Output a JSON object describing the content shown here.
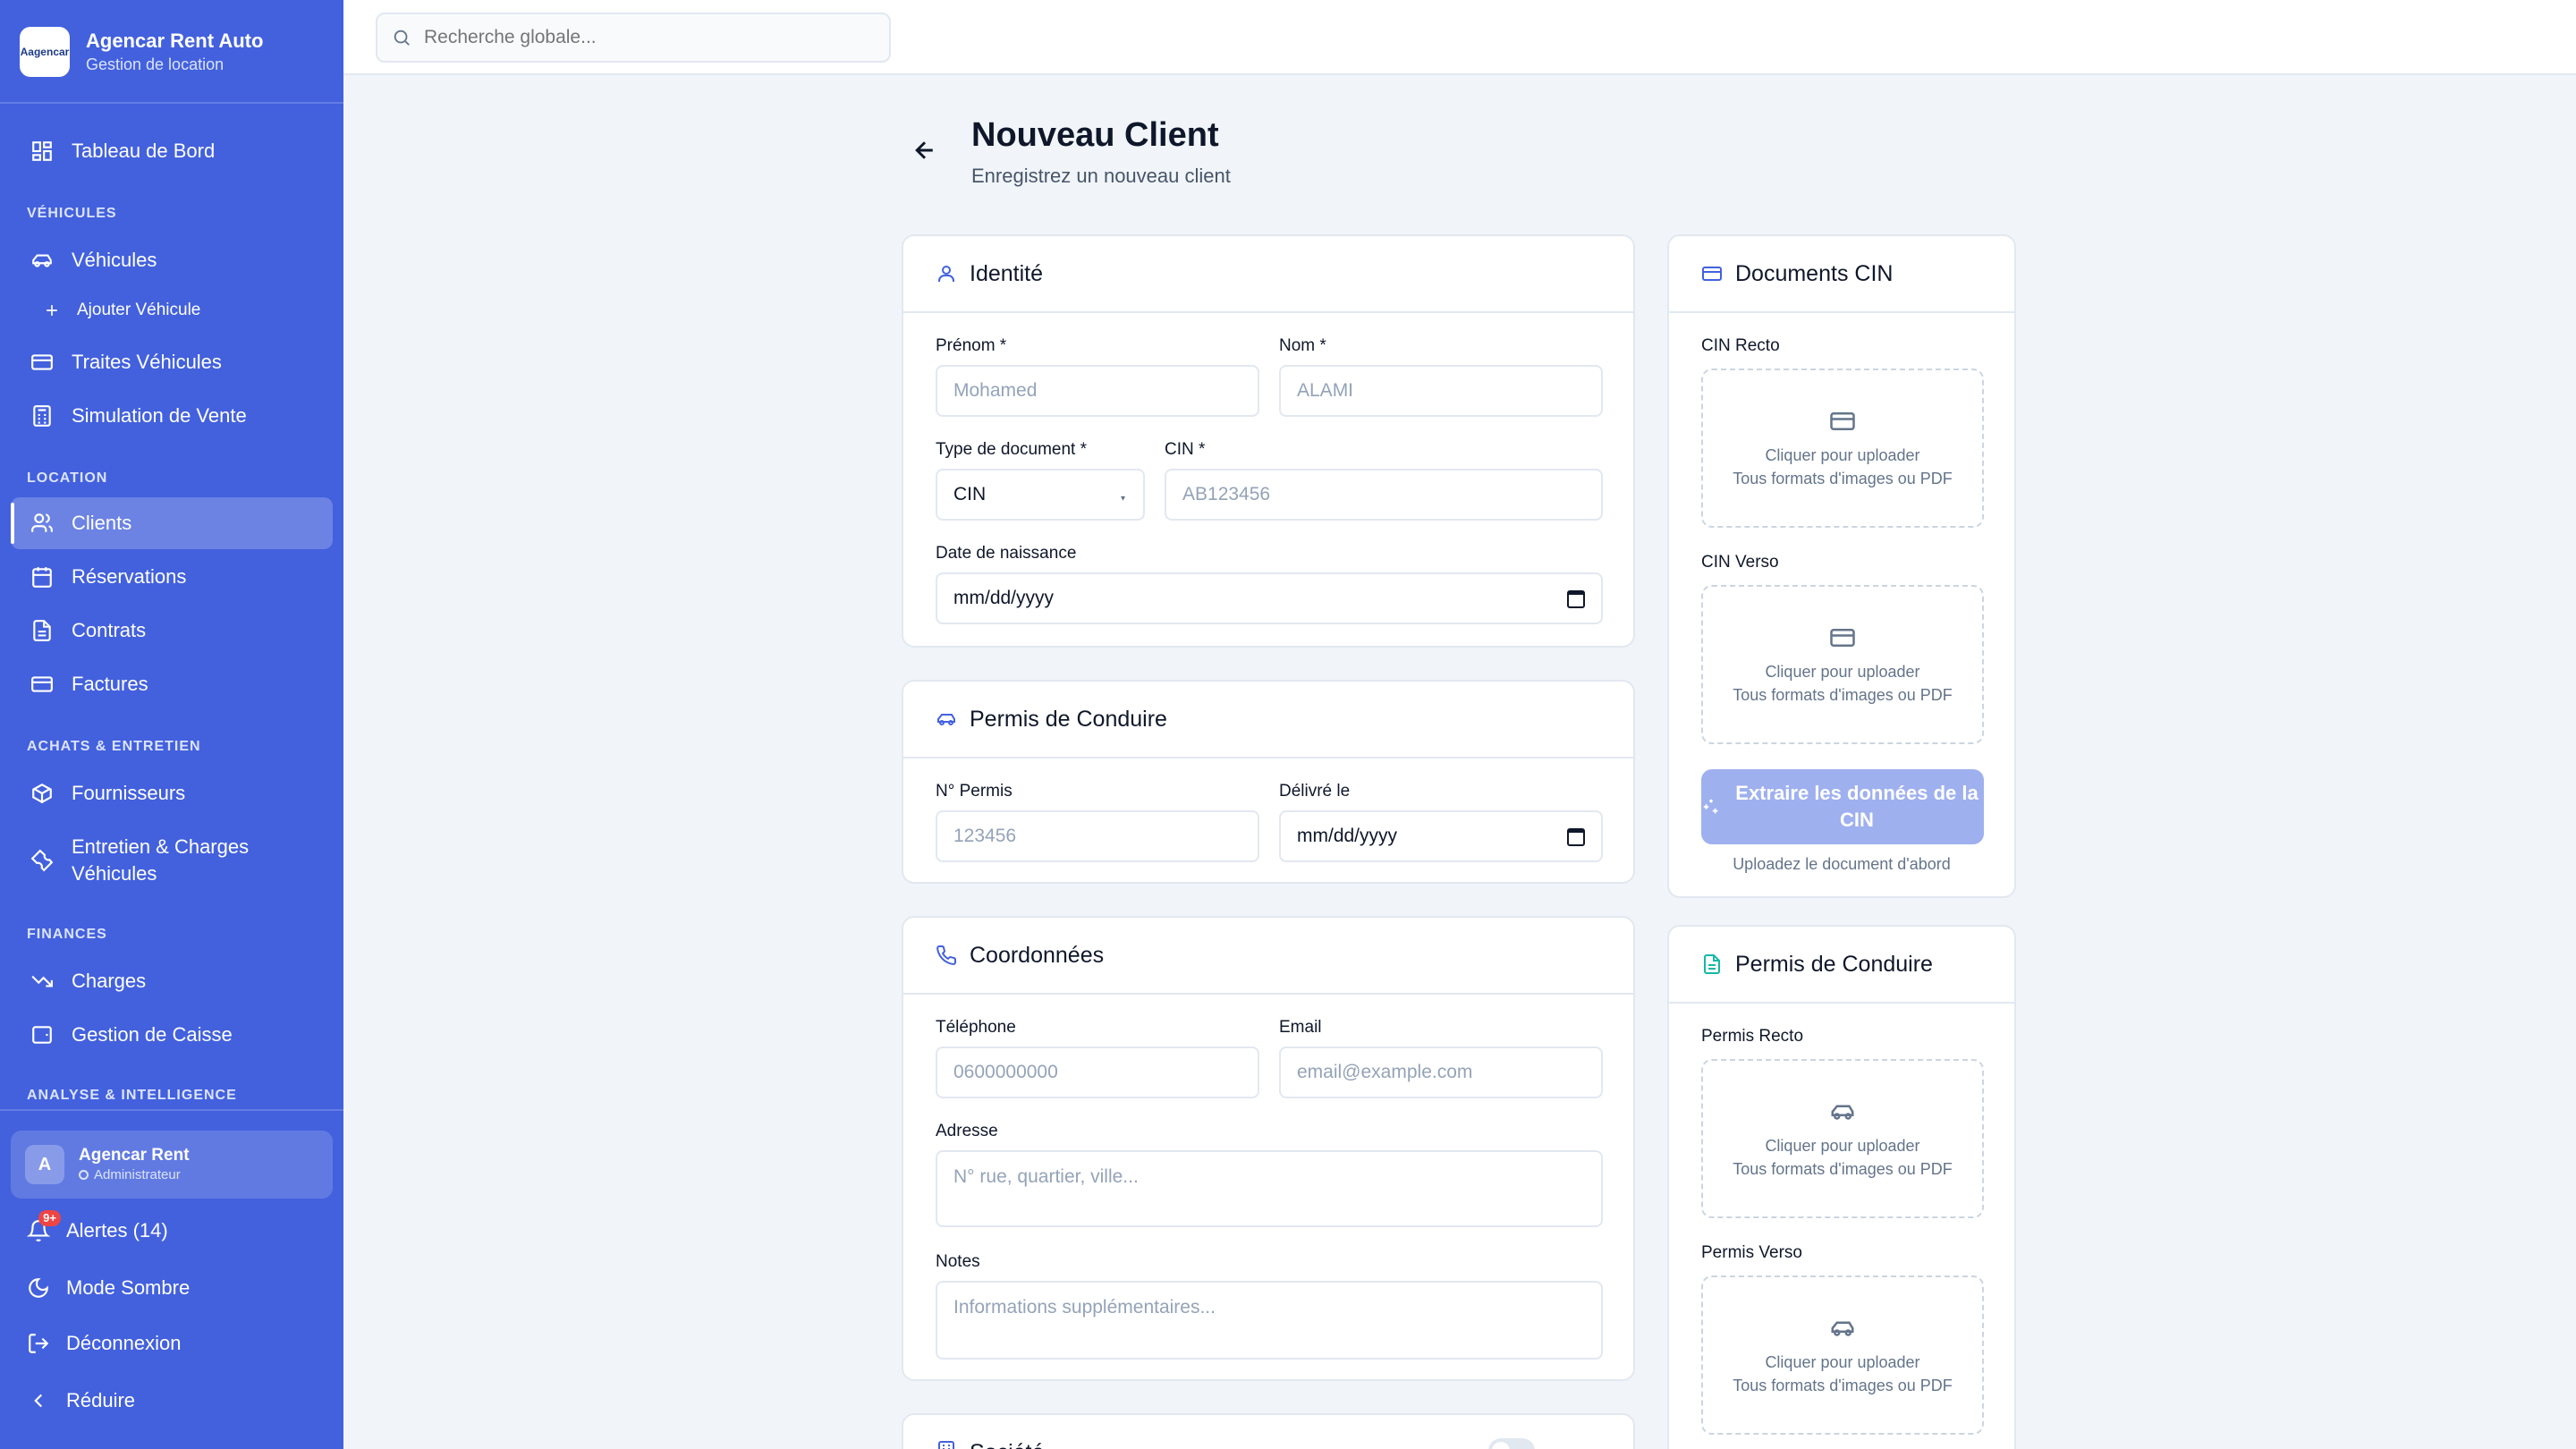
{
  "brand": {
    "logo_text": "Aagencar",
    "title": "Agencar Rent Auto",
    "subtitle": "Gestion de location"
  },
  "nav": {
    "dashboard": "Tableau de Bord",
    "section_vehicles": "VÉHICULES",
    "vehicles": "Véhicules",
    "add_vehicle": "Ajouter Véhicule",
    "vehicle_installments": "Traites Véhicules",
    "sale_simulation": "Simulation de Vente",
    "section_rental": "LOCATION",
    "clients": "Clients",
    "reservations": "Réservations",
    "contracts": "Contrats",
    "invoices": "Factures",
    "section_purchases": "ACHATS & ENTRETIEN",
    "suppliers": "Fournisseurs",
    "maintenance_line1": "Entretien & Charges",
    "maintenance_line2": "Véhicules",
    "section_finances": "FINANCES",
    "charges": "Charges",
    "cash": "Gestion de Caisse",
    "section_analysis": "ANALYSE & INTELLIGENCE"
  },
  "user": {
    "initial": "A",
    "name": "Agencar Rent",
    "role": "Administrateur"
  },
  "footer": {
    "alerts": "Alertes (14)",
    "alerts_badge": "9+",
    "dark_mode": "Mode Sombre",
    "logout": "Déconnexion",
    "collapse": "Réduire"
  },
  "search": {
    "placeholder": "Recherche globale..."
  },
  "page": {
    "title": "Nouveau Client",
    "subtitle": "Enregistrez un nouveau client"
  },
  "identity": {
    "title": "Identité",
    "first_name_label": "Prénom *",
    "first_name_placeholder": "Mohamed",
    "last_name_label": "Nom *",
    "last_name_placeholder": "ALAMI",
    "doc_type_label": "Type de document *",
    "doc_type_value": "CIN",
    "cin_label": "CIN *",
    "cin_placeholder": "AB123456",
    "birth_label": "Date de naissance",
    "birth_value": "mm/dd/yyyy"
  },
  "license": {
    "title": "Permis de Conduire",
    "number_label": "N° Permis",
    "number_placeholder": "123456",
    "issued_label": "Délivré le",
    "issued_value": "mm/dd/yyyy"
  },
  "contact": {
    "title": "Coordonnées",
    "phone_label": "Téléphone",
    "phone_placeholder": "0600000000",
    "email_label": "Email",
    "email_placeholder": "email@example.com",
    "address_label": "Adresse",
    "address_placeholder": "N° rue, quartier, ville...",
    "notes_label": "Notes",
    "notes_placeholder": "Informations supplémentaires..."
  },
  "company": {
    "title": "Société"
  },
  "cin_docs": {
    "title": "Documents CIN",
    "recto_label": "CIN Recto",
    "verso_label": "CIN Verso",
    "upload_line1": "Cliquer pour uploader",
    "upload_line2": "Tous formats d'images ou PDF",
    "extract_button": "Extraire les données de la CIN",
    "extract_hint": "Uploadez le document d'abord"
  },
  "license_docs": {
    "title": "Permis de Conduire",
    "recto_label": "Permis Recto",
    "verso_label": "Permis Verso",
    "upload_line1": "Cliquer pour uploader",
    "upload_line2": "Tous formats d'images ou PDF"
  },
  "colors": {
    "sidebar": "#4361dd",
    "accent": "#4361dd",
    "background": "#f1f5f9",
    "license_docs_icon": "#14b8a6"
  }
}
